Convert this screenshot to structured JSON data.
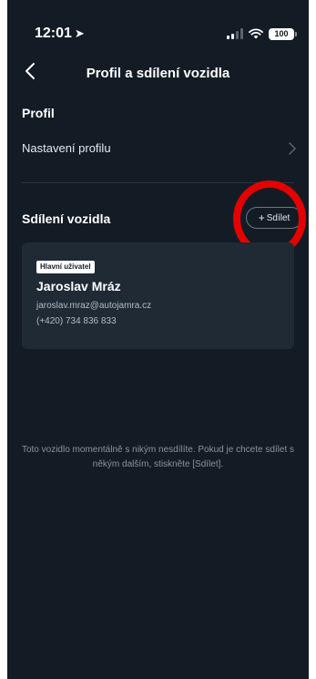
{
  "status_bar": {
    "time": "12:01",
    "battery": "100"
  },
  "header": {
    "title": "Profil a sdílení vozidla"
  },
  "profile": {
    "heading": "Profil",
    "settings_label": "Nastavení profilu"
  },
  "sharing": {
    "heading": "Sdílení vozidla",
    "share_button_label": "Sdílet",
    "highlight_color": "#e40000"
  },
  "user_card": {
    "badge": "Hlavní uživatel",
    "name": "Jaroslav Mráz",
    "email": "jaroslav.mraz@autojamra.cz",
    "phone": "(+420) 734 836 833"
  },
  "info": {
    "message": "Toto vozidlo momentálně s nikým nesdílíte. Pokud je chcete sdílet s někým dalším, stiskněte [Sdílet]."
  },
  "colors": {
    "background": "#131c25",
    "card": "#1f2a35",
    "text_muted": "#8a949e"
  }
}
